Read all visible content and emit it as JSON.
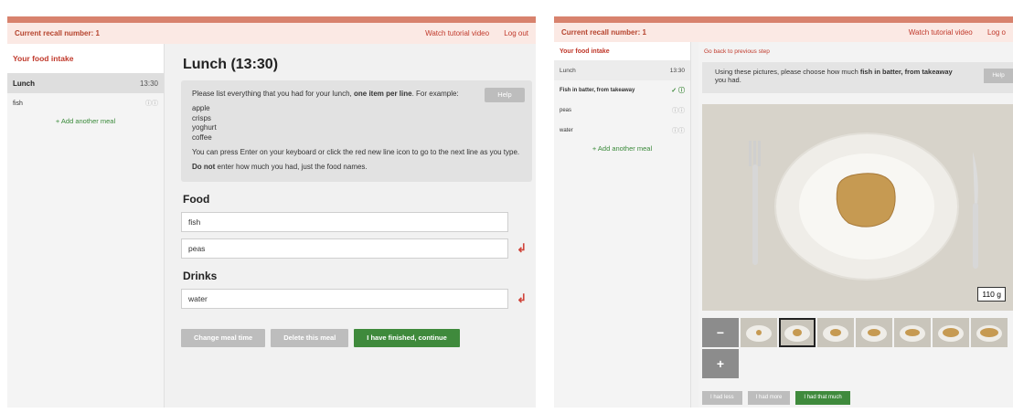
{
  "left": {
    "topbar": {
      "recall": "Current recall number: 1",
      "tutorial": "Watch tutorial video",
      "logout": "Log out"
    },
    "sidebar": {
      "title": "Your food intake",
      "meal_name": "Lunch",
      "meal_time": "13:30",
      "items": [
        {
          "label": "fish",
          "status": "?"
        }
      ],
      "add_meal": "+ Add another meal"
    },
    "main": {
      "title": "Lunch (13:30)",
      "help": {
        "intro_a": "Please list everything that you had for your lunch, ",
        "intro_bold": "one item per line",
        "intro_b": ". For example:",
        "examples": [
          "apple",
          "crisps",
          "yoghurt",
          "coffee"
        ],
        "enter_note": "You can press Enter on your keyboard or click the red new line icon to go to the next line as you type.",
        "donot_bold": "Do not",
        "donot_rest": " enter how much you had, just the food names.",
        "button": "Help"
      },
      "food_heading": "Food",
      "foods": [
        "fish",
        "peas"
      ],
      "drinks_heading": "Drinks",
      "drinks": [
        "water"
      ],
      "buttons": {
        "change_time": "Change meal time",
        "delete_meal": "Delete this meal",
        "finished": "I have finished, continue"
      }
    }
  },
  "right": {
    "topbar": {
      "recall": "Current recall number: 1",
      "tutorial": "Watch tutorial video",
      "logout": "Log o"
    },
    "sidebar": {
      "title": "Your food intake",
      "meal_name": "Lunch",
      "meal_time": "13:30",
      "items": [
        {
          "label": "Fish in batter, from takeaway",
          "status": "✓ ?"
        },
        {
          "label": "peas",
          "status": "?"
        },
        {
          "label": "water",
          "status": "?"
        }
      ],
      "add_meal": "+ Add another meal"
    },
    "main": {
      "back": "Go back to previous step",
      "prompt_a": "Using these pictures, please choose how much ",
      "prompt_bold": "fish in batter, from takeaway",
      "prompt_b": " you had.",
      "help_button": "Help",
      "weight": "110 g",
      "buttons": {
        "less": "I had less",
        "more": "I had more",
        "that_much": "I had that much"
      }
    }
  }
}
